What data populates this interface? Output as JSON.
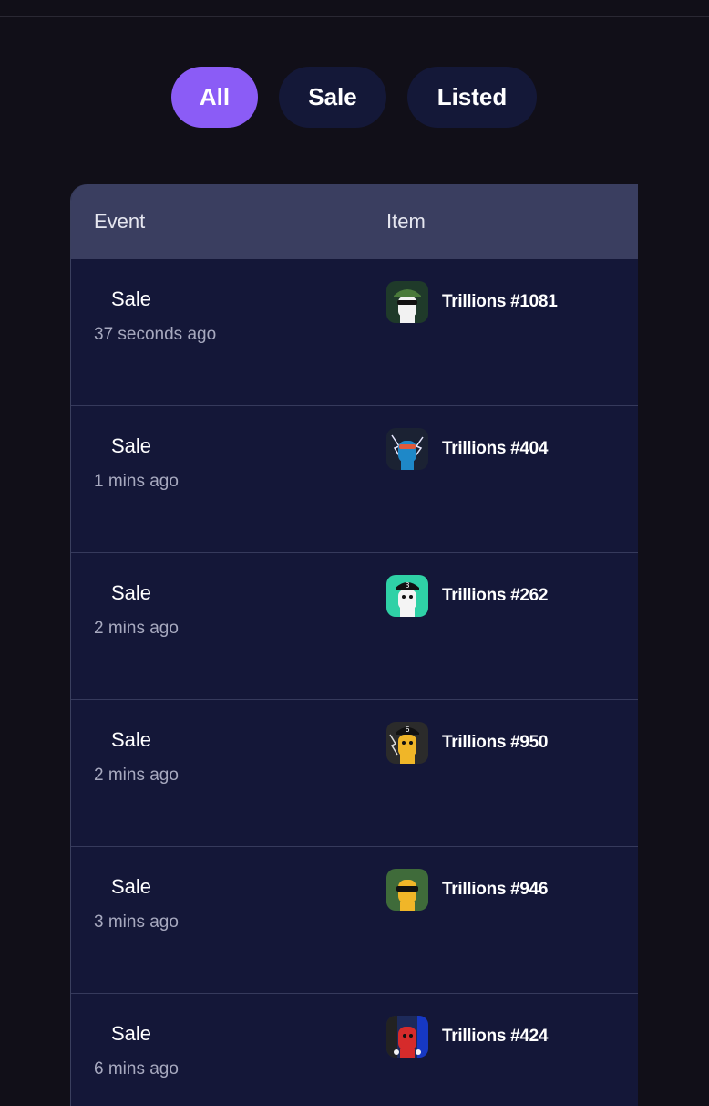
{
  "filters": [
    {
      "label": "All",
      "active": true
    },
    {
      "label": "Sale",
      "active": false
    },
    {
      "label": "Listed",
      "active": false
    }
  ],
  "table": {
    "headers": {
      "event": "Event",
      "item": "Item"
    },
    "rows": [
      {
        "event": "Sale",
        "time": "37 seconds ago",
        "item": "Trillions #1081",
        "thumb_icon": "nft-avatar-icon",
        "thumb_bg": "#1f3a2a",
        "thumb_accent": "#f2f2f2"
      },
      {
        "event": "Sale",
        "time": "1 mins ago",
        "item": "Trillions #404",
        "thumb_icon": "nft-avatar-icon",
        "thumb_bg": "#1b2233",
        "thumb_accent": "#1e88c8"
      },
      {
        "event": "Sale",
        "time": "2 mins ago",
        "item": "Trillions #262",
        "thumb_icon": "nft-avatar-icon",
        "thumb_bg": "#2fd1a6",
        "thumb_accent": "#f4f4f4"
      },
      {
        "event": "Sale",
        "time": "2 mins ago",
        "item": "Trillions #950",
        "thumb_icon": "nft-avatar-icon",
        "thumb_bg": "#2b2b2b",
        "thumb_accent": "#f0b628"
      },
      {
        "event": "Sale",
        "time": "3 mins ago",
        "item": "Trillions #946",
        "thumb_icon": "nft-avatar-icon",
        "thumb_bg": "#3f6b3a",
        "thumb_accent": "#f0b628"
      },
      {
        "event": "Sale",
        "time": "6 mins ago",
        "item": "Trillions #424",
        "thumb_icon": "nft-avatar-icon",
        "thumb_bg": "#1d2a5a",
        "thumb_accent": "#d62b2b"
      }
    ]
  },
  "colors": {
    "page_bg": "#110f18",
    "accent": "#8b5cf6",
    "pill_bg": "#141838",
    "table_bg": "#141738",
    "header_bg": "#3a3e60"
  }
}
